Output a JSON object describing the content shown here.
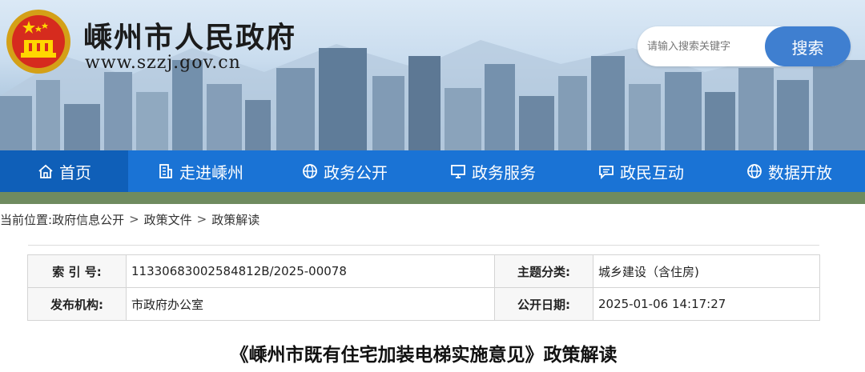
{
  "header": {
    "site_title": "嵊州市人民政府",
    "site_url": "www.szzj.gov.cn",
    "emblem_icon": "national-emblem-icon"
  },
  "search": {
    "placeholder": "请输入搜索关键字",
    "button_label": "搜索"
  },
  "nav": {
    "items": [
      {
        "label": "首页",
        "icon": "home-icon"
      },
      {
        "label": "走进嵊州",
        "icon": "building-icon"
      },
      {
        "label": "政务公开",
        "icon": "globe-icon"
      },
      {
        "label": "政务服务",
        "icon": "monitor-icon"
      },
      {
        "label": "政民互动",
        "icon": "chat-icon"
      },
      {
        "label": "数据开放",
        "icon": "globe-icon"
      }
    ],
    "accent_color": "#1a73d5"
  },
  "breadcrumb": {
    "prefix": "当前位置:",
    "items": [
      "政府信息公开",
      "政策文件",
      "政策解读"
    ],
    "separator": ">"
  },
  "meta": {
    "index_label": "索 引 号:",
    "index_value": "11330683002584812B/2025-00078",
    "topic_label": "主题分类:",
    "topic_value": "城乡建设（含住房)",
    "publisher_label": "发布机构:",
    "publisher_value": "市政府办公室",
    "date_label": "公开日期:",
    "date_value": "2025-01-06 14:17:27"
  },
  "article": {
    "title": "《嵊州市既有住宅加装电梯实施意见》政策解读"
  }
}
